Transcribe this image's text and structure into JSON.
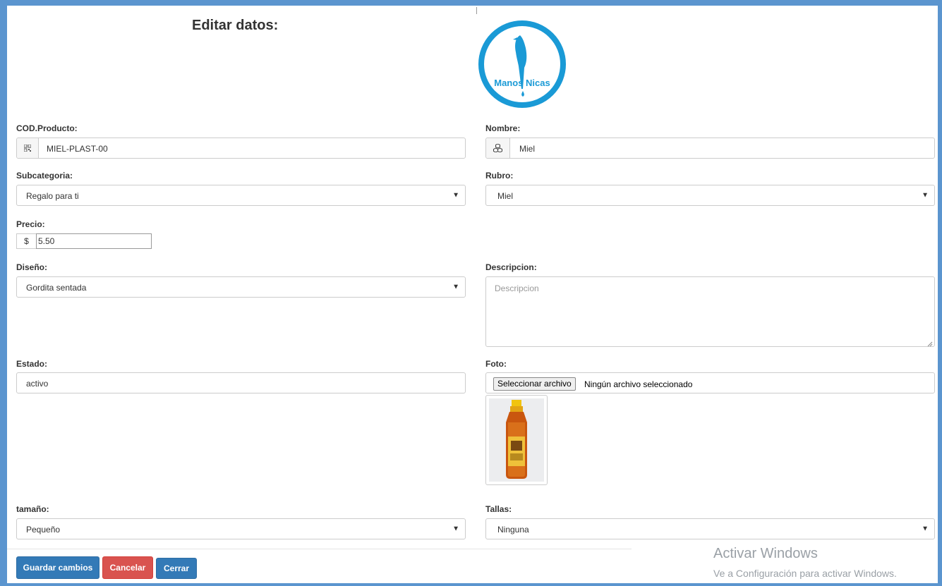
{
  "modal": {
    "title": "Editar datos:",
    "logo_text": "Manos Nicas"
  },
  "form": {
    "cod": {
      "label": "COD.Producto:",
      "value": "MIEL-PLAST-00",
      "icon": "qrcode-icon"
    },
    "nombre": {
      "label": "Nombre:",
      "value": "Miel",
      "icon": "cubes-icon"
    },
    "subcategoria": {
      "label": "Subcategoria:",
      "selected": "Regalo para ti"
    },
    "rubro": {
      "label": "Rubro:",
      "selected": "Miel"
    },
    "precio": {
      "label": "Precio:",
      "prefix": "$",
      "value": "5.50"
    },
    "diseno": {
      "label": "Diseño:",
      "selected": "Gordita sentada"
    },
    "descripcion": {
      "label": "Descripcion:",
      "placeholder": "Descripcion",
      "value": ""
    },
    "estado": {
      "label": "Estado:",
      "value": "activo"
    },
    "foto": {
      "label": "Foto:",
      "button": "Seleccionar archivo",
      "status": "Ningún archivo seleccionado"
    },
    "tamano": {
      "label": "tamaño:",
      "selected": "Pequeño"
    },
    "tallas": {
      "label": "Tallas:",
      "selected": "Ninguna"
    }
  },
  "footer": {
    "save": "Guardar cambios",
    "cancel": "Cancelar",
    "close": "Cerrar"
  },
  "watermark": {
    "line1": "Activar Windows",
    "line2": "Ve a Configuración para activar Windows."
  },
  "colors": {
    "frame": "#5b95cf",
    "primary": "#337ab7",
    "danger": "#d9534f",
    "logo": "#1a9ad6"
  }
}
